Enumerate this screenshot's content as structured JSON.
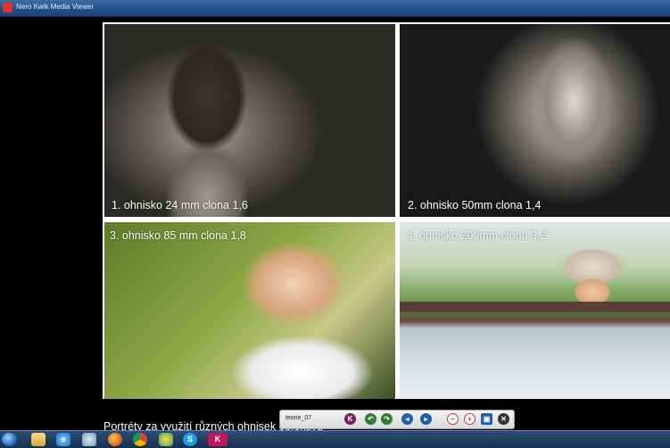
{
  "window": {
    "title": "Nero Kwik Media Viewer"
  },
  "photos": [
    {
      "caption": "1. ohnisko 24 mm  clona 1,6"
    },
    {
      "caption": "2. ohnisko 50mm  clona 1,4"
    },
    {
      "caption": "3. ohnisko 85 mm  clona 1,8"
    },
    {
      "caption": "4. ohnisko 200mm  clona 3,2"
    }
  ],
  "footer_text": "Portréty za využití různých ohnisek objektivu",
  "controlbar": {
    "filename": "teorie_07",
    "buttons": [
      {
        "icon": "nero-k-icon",
        "glyph": "K"
      },
      {
        "icon": "rotate-left-icon",
        "glyph": "↶"
      },
      {
        "icon": "rotate-right-icon",
        "glyph": "↷"
      },
      {
        "icon": "previous-icon",
        "glyph": "◂"
      },
      {
        "icon": "next-icon",
        "glyph": "▸"
      },
      {
        "icon": "zoom-out-icon",
        "glyph": "−"
      },
      {
        "icon": "zoom-in-icon",
        "glyph": "+"
      },
      {
        "icon": "fullscreen-icon",
        "glyph": "▣"
      },
      {
        "icon": "close-icon",
        "glyph": "✕"
      }
    ]
  },
  "taskbar": {
    "items": [
      {
        "icon": "windows-start-icon",
        "glyph": ""
      },
      {
        "icon": "file-explorer-icon",
        "glyph": ""
      },
      {
        "icon": "internet-explorer-icon",
        "glyph": "e"
      },
      {
        "icon": "tool-icon",
        "glyph": ""
      },
      {
        "icon": "firefox-icon",
        "glyph": ""
      },
      {
        "icon": "chrome-icon",
        "glyph": ""
      },
      {
        "icon": "flower-app-icon",
        "glyph": ""
      },
      {
        "icon": "skype-icon",
        "glyph": "S"
      },
      {
        "icon": "nero-kwik-icon",
        "glyph": "K"
      }
    ]
  },
  "colors": {
    "titlebar": "#1f4f86",
    "background": "#000000",
    "taskbar": "#16304f"
  }
}
